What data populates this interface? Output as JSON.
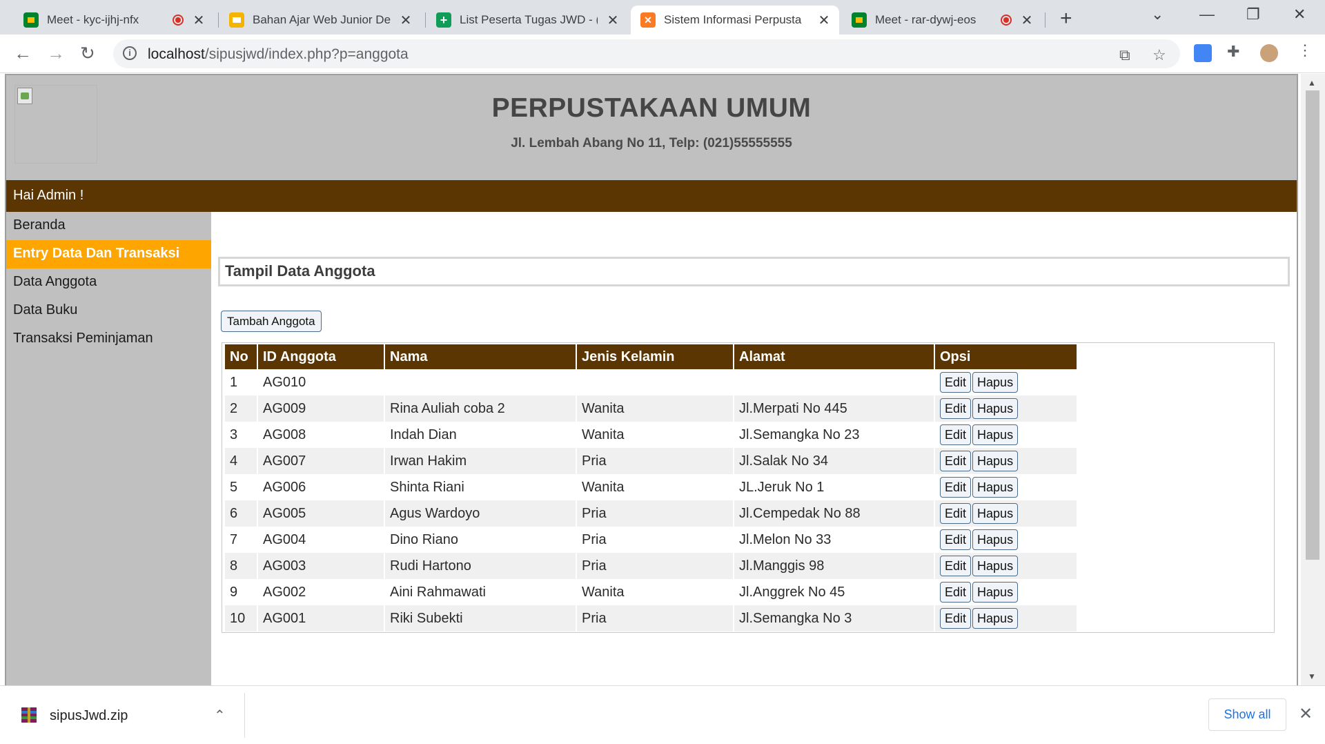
{
  "browser": {
    "tabs": [
      {
        "title": "Meet - kyc-ijhj-nfx",
        "icon": "google-meet-icon",
        "recording": true
      },
      {
        "title": "Bahan Ajar Web Junior De",
        "icon": "google-slides-icon",
        "recording": false
      },
      {
        "title": "List Peserta Tugas JWD - (",
        "icon": "google-sheets-icon",
        "recording": false
      },
      {
        "title": "Sistem Informasi Perpusta",
        "icon": "xampp-icon",
        "recording": false,
        "active": true
      },
      {
        "title": "Meet - rar-dywj-eos",
        "icon": "google-meet-icon",
        "recording": true
      }
    ],
    "url_host": "localhost",
    "url_rest": "/sipusjwd/index.php?p=anggota"
  },
  "site": {
    "title": "PERPUSTAKAAN UMUM",
    "address": "Jl. Lembah Abang No 11, Telp: (021)55555555",
    "greeting": "Hai Admin !"
  },
  "sidebar": {
    "items": [
      {
        "label": "Beranda",
        "active": false
      },
      {
        "label": "Entry Data Dan Transaksi",
        "active": true
      },
      {
        "label": "Data Anggota",
        "active": false
      },
      {
        "label": "Data Buku",
        "active": false
      },
      {
        "label": "Transaksi Peminjaman",
        "active": false
      }
    ]
  },
  "main": {
    "panel_title": "Tampil Data Anggota",
    "add_button": "Tambah Anggota",
    "columns": [
      "No",
      "ID Anggota",
      "Nama",
      "Jenis Kelamin",
      "Alamat",
      "Opsi"
    ],
    "edit_label": "Edit",
    "delete_label": "Hapus",
    "rows": [
      {
        "no": "1",
        "id": "AG010",
        "nama": "",
        "jk": "",
        "alamat": ""
      },
      {
        "no": "2",
        "id": "AG009",
        "nama": "Rina Auliah coba 2",
        "jk": "Wanita",
        "alamat": "Jl.Merpati No 445"
      },
      {
        "no": "3",
        "id": "AG008",
        "nama": "Indah Dian",
        "jk": "Wanita",
        "alamat": "Jl.Semangka No 23"
      },
      {
        "no": "4",
        "id": "AG007",
        "nama": "Irwan Hakim",
        "jk": "Pria",
        "alamat": "Jl.Salak No 34"
      },
      {
        "no": "5",
        "id": "AG006",
        "nama": "Shinta Riani",
        "jk": "Wanita",
        "alamat": "JL.Jeruk No 1"
      },
      {
        "no": "6",
        "id": "AG005",
        "nama": "Agus Wardoyo",
        "jk": "Pria",
        "alamat": "Jl.Cempedak No 88"
      },
      {
        "no": "7",
        "id": "AG004",
        "nama": "Dino Riano",
        "jk": "Pria",
        "alamat": "Jl.Melon No 33"
      },
      {
        "no": "8",
        "id": "AG003",
        "nama": "Rudi Hartono",
        "jk": "Pria",
        "alamat": "Jl.Manggis 98"
      },
      {
        "no": "9",
        "id": "AG002",
        "nama": "Aini Rahmawati",
        "jk": "Wanita",
        "alamat": "Jl.Anggrek No 45"
      },
      {
        "no": "10",
        "id": "AG001",
        "nama": "Riki Subekti",
        "jk": "Pria",
        "alamat": "Jl.Semangka No 3"
      }
    ]
  },
  "downloads": {
    "file_name": "sipusJwd.zip",
    "show_all": "Show all"
  },
  "colors": {
    "header_bg": "#c0c0c0",
    "brand_brown": "#5c3602",
    "active_orange": "#ffa500"
  }
}
